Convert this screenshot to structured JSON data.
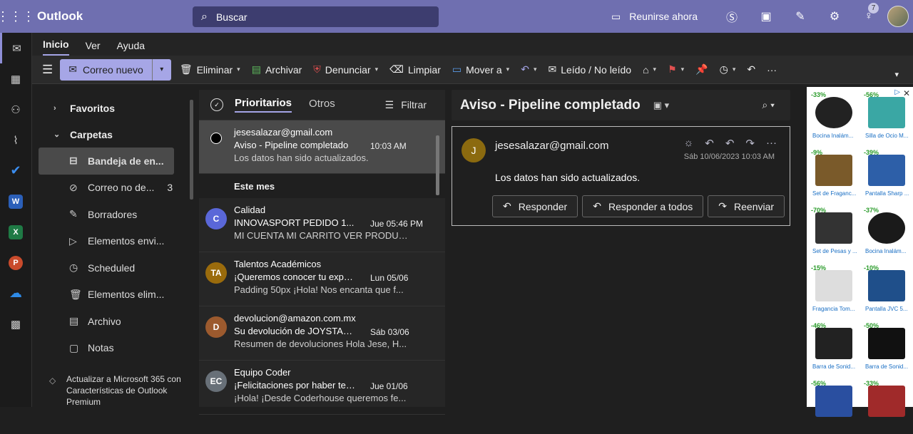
{
  "topbar": {
    "app_name": "Outlook",
    "search_placeholder": "Buscar",
    "meet_label": "Reunirse ahora",
    "notifications_count": "7"
  },
  "ribbon": {
    "tabs": [
      {
        "label": "Inicio"
      },
      {
        "label": "Ver"
      },
      {
        "label": "Ayuda"
      }
    ],
    "new_mail": "Correo nuevo",
    "delete": "Eliminar",
    "archive": "Archivar",
    "report": "Denunciar",
    "sweep": "Limpiar",
    "move": "Mover a",
    "read_unread": "Leído / No leído"
  },
  "folders": {
    "favorites": "Favoritos",
    "folders": "Carpetas",
    "items": [
      {
        "label": "Bandeja de en..."
      },
      {
        "label": "Correo no de...",
        "count": "3"
      },
      {
        "label": "Borradores"
      },
      {
        "label": "Elementos envi..."
      },
      {
        "label": "Scheduled"
      },
      {
        "label": "Elementos elim..."
      },
      {
        "label": "Archivo"
      },
      {
        "label": "Notas"
      }
    ],
    "upgrade": "Actualizar a Microsoft 365 con Características de Outlook Premium"
  },
  "list": {
    "tab_focused": "Prioritarios",
    "tab_other": "Otros",
    "filter": "Filtrar",
    "section": "Este mes",
    "selected": {
      "from": "jesesalazar@gmail.com",
      "subject": "Aviso - Pipeline completado",
      "time": "10:03 AM",
      "preview": "Los datos han sido actualizados."
    },
    "messages": [
      {
        "initials": "C",
        "color": "#5a67d8",
        "from": "Calidad",
        "subject": "INNOVASPORT PEDIDO 1...",
        "time": "Jue 05:46 PM",
        "preview": "MI CUENTA MI CARRITO VER PRODUC..."
      },
      {
        "initials": "TA",
        "color": "#9a6b0c",
        "from": "Talentos Académicos",
        "subject": "¡Queremos conocer tu expe...",
        "time": "Lun 05/06",
        "preview": "Padding 50px ¡Hola! Nos encanta que f..."
      },
      {
        "initials": "D",
        "color": "#9c5a2e",
        "from": "devolucion@amazon.com.mx",
        "subject": "Su devolución de JOYSTAR ...",
        "time": "Sáb 03/06",
        "preview": "Resumen de devoluciones Hola Jese, H..."
      },
      {
        "initials": "EC",
        "color": "#687078",
        "from": "Equipo Coder",
        "subject": "¡Felicitaciones por haber ter...",
        "time": "Jue 01/06",
        "preview": "¡Hola! ¡Desde Coderhouse queremos fe..."
      }
    ]
  },
  "reading": {
    "title": "Aviso - Pipeline completado",
    "avatar": "J",
    "sender": "jesesalazar@gmail.com",
    "date": "Sáb 10/06/2023 10:03 AM",
    "body": "Los datos han sido actualizados.",
    "reply": "Responder",
    "reply_all": "Responder a todos",
    "forward": "Reenviar"
  },
  "ads": [
    {
      "pct": "-33%",
      "label": "Bocina Inalám..."
    },
    {
      "pct": "-56%",
      "label": "Silla de Ocio M..."
    },
    {
      "pct": "-9%",
      "label": "Set de Fraganc..."
    },
    {
      "pct": "-39%",
      "label": "Pantalla Sharp ..."
    },
    {
      "pct": "-70%",
      "label": "Set de Pesas y ..."
    },
    {
      "pct": "-37%",
      "label": "Bocina Inalám..."
    },
    {
      "pct": "-15%",
      "label": "Fragancia Tom..."
    },
    {
      "pct": "-10%",
      "label": "Pantalla JVC 5..."
    },
    {
      "pct": "-46%",
      "label": "Barra de Sonid..."
    },
    {
      "pct": "-50%",
      "label": "Barra de Sonid..."
    },
    {
      "pct": "-56%",
      "label": ""
    },
    {
      "pct": "-33%",
      "label": ""
    }
  ]
}
